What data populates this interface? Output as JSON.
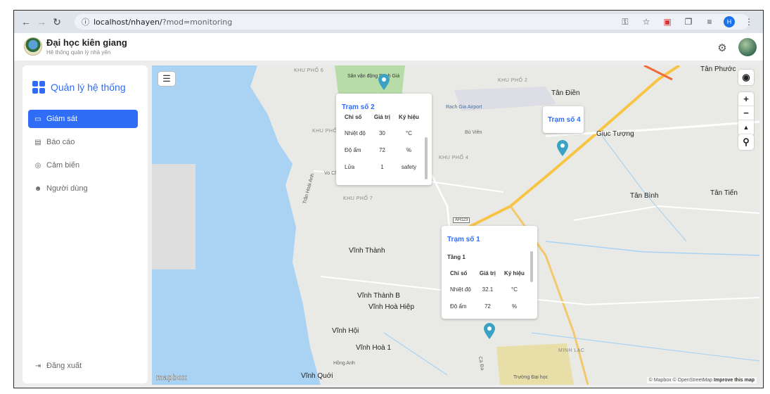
{
  "browser": {
    "url_host": "localhost/nhayen/",
    "url_path": "?mod=monitoring",
    "profile_initial": "H"
  },
  "header": {
    "title": "Đại học kiên giang",
    "subtitle": "Hệ thống quản lý nhà yến"
  },
  "sidebar": {
    "title": "Quản lý hệ thống",
    "items": [
      {
        "label": "Giám sát",
        "active": true
      },
      {
        "label": "Báo cáo",
        "active": false
      },
      {
        "label": "Cảm biến",
        "active": false
      },
      {
        "label": "Người dùng",
        "active": false
      }
    ],
    "logout": "Đăng xuất"
  },
  "map": {
    "places": {
      "khu_pho_6": "KHU PHỐ 6",
      "khu_pho_2": "KHU PHỐ 2",
      "khu_pho_4": "KHU PHỐ 4",
      "khu_pho_7": "KHU PHỐ 7",
      "khu_pho": "KHU PHỐ",
      "san_van_dong": "Sân vận động Rạch Giá",
      "airport": "Rach Gia Airport",
      "tan_dien": "Tân Điền",
      "giuc_tuong": "Giục Tượng",
      "tan_phuoc": "Tân Phước",
      "tan_binh": "Tân Bình",
      "tan_tien": "Tân Tiến",
      "vinh_thanh": "Vĩnh Thành",
      "vinh_thanh_b": "Vĩnh Thành B",
      "vinh_hoa_hiep": "Vĩnh Hoà Hiệp",
      "vinh_hoi": "Vĩnh Hội",
      "vinh_hoa_1": "Vĩnh Hoà 1",
      "vinh_quoi": "Vĩnh Quới",
      "minh_lac": "MINH LẠC",
      "truong_dai_hoc": "Trường Đại học",
      "ah123": "AH123",
      "tran_hoai_anh": "Trần Hoài Anh",
      "vo_chua": "Vo Chúa",
      "bu_vien": "Bù Viên",
      "hung_anh": "Hồng Anh",
      "ca_da": "Cà Đa"
    },
    "attribution_prefix": "© Mapbox © OpenStreetMap",
    "attribution_link": "Improve this map",
    "logo": "mapbox"
  },
  "stations": [
    {
      "title": "Trạm số 2",
      "columns": [
        "Chỉ số",
        "Giá trị",
        "Ký hiệu"
      ],
      "rows": [
        [
          "Nhiệt độ",
          "30",
          "°C"
        ],
        [
          "Độ ẩm",
          "72",
          "%"
        ],
        [
          "Lửa",
          "1",
          "safety"
        ]
      ]
    },
    {
      "title": "Trạm số 1",
      "floor": "Tầng 1",
      "columns": [
        "Chỉ số",
        "Giá trị",
        "Ký hiệu"
      ],
      "rows": [
        [
          "Nhiệt độ",
          "32.1",
          "°C"
        ],
        [
          "Độ ẩm",
          "72",
          "%"
        ]
      ]
    },
    {
      "title": "Trạm số 4"
    }
  ],
  "icons": {
    "back": "arrow-left-icon",
    "forward": "arrow-right-icon",
    "reload": "reload-icon",
    "info": "info-icon",
    "gear": "gear-icon",
    "menu": "hamburger-icon",
    "locate": "locate-icon",
    "compass": "compass-icon",
    "pin": "map-pin-icon"
  },
  "colors": {
    "accent": "#2f6df6",
    "pin": "#3aa3c4",
    "water": "#aad3f3"
  }
}
